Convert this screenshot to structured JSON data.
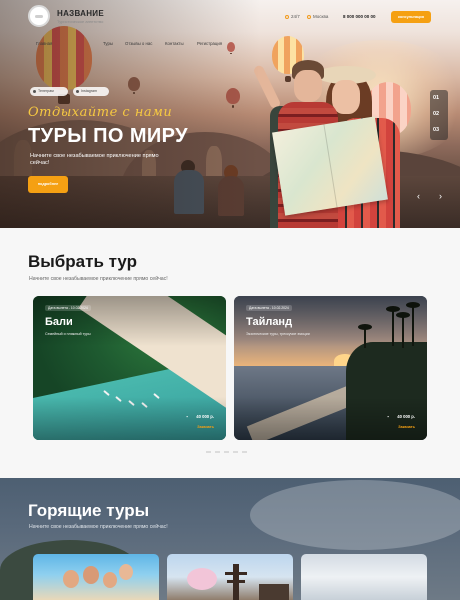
{
  "header": {
    "brand": "НАЗВАНИЕ",
    "brand_sub": "Туристическое агентство",
    "hours": "24/7",
    "city": "Москва",
    "phone": "8 000 000 00 00",
    "consult_label": "консультация"
  },
  "nav": {
    "items": [
      "Главная",
      "Туры",
      "Отзывы о нас",
      "Контакты",
      "Регистрация"
    ]
  },
  "hero": {
    "social": [
      "Телеграм",
      "Instagram"
    ],
    "script": "Отдыхайте с нами",
    "title": "ТУРЫ ПО МИРУ",
    "subtitle": "Начните свое незабываемое приключение прямо сейчас!",
    "button": "подробнее",
    "slides": [
      "01",
      "02",
      "03"
    ],
    "prev_icon": "‹",
    "next_icon": "›"
  },
  "choose": {
    "title": "Выбрать тур",
    "subtitle": "Начните свое незабываемое приключение прямо сейчас!",
    "cards": [
      {
        "date": "Дата вылета - 10.02.2024",
        "name": "Бали",
        "desc": "Семейный и пляжный туры",
        "price": "40 000 р.",
        "order": "Заказать"
      },
      {
        "date": "Дата вылета - 10.02.2024",
        "name": "Тайланд",
        "desc": "Экзотические туры, трескучие эмоции",
        "price": "40 000 р.",
        "order": "Заказать"
      }
    ]
  },
  "hot": {
    "title": "Горящие туры",
    "subtitle": "Начните свое незабываемое приключение прямо сейчас!"
  },
  "colors": {
    "accent": "#f5a013",
    "hero_script": "#f5c842",
    "hot_bg": "#59697b"
  },
  "icons": {
    "clock": "clock-icon",
    "location": "location-pin-icon",
    "telegram": "telegram-icon",
    "instagram": "instagram-icon",
    "price": "wallet-icon"
  }
}
